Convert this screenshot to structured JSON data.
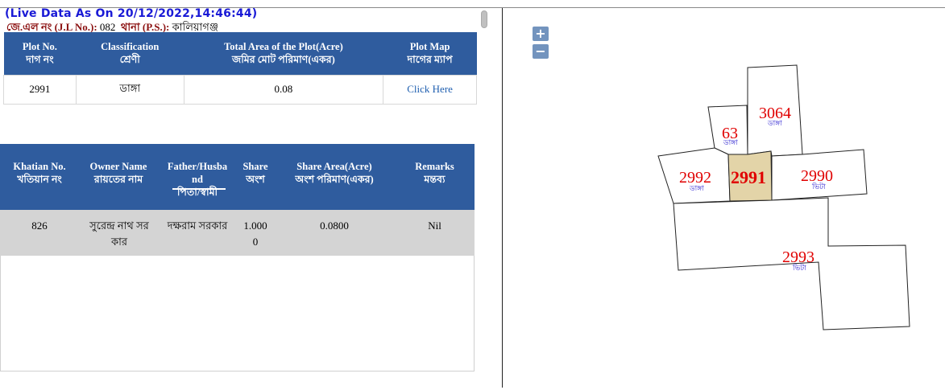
{
  "header": {
    "live_data": "(Live Data As On 20/12/2022,14:46:44)",
    "jl_label": "জে.এল নং (J.L No.):",
    "jl_value": "082",
    "ps_label": "থানা (P.S.):",
    "ps_value": "কালিয়াগঞ্জ"
  },
  "plot_table": {
    "headers": [
      {
        "en": "Plot No.",
        "bn": "দাগ নং"
      },
      {
        "en": "Classification",
        "bn": "শ্রেণী"
      },
      {
        "en": "Total Area of the Plot(Acre)",
        "bn": "জমির মোট পরিমাণ(একর)"
      },
      {
        "en": "Plot Map",
        "bn": "দাগের ম্যাপ"
      }
    ],
    "row": {
      "plot_no": "2991",
      "classification": "ডাঙ্গা",
      "total_area": "0.08",
      "plot_map_link": "Click Here"
    }
  },
  "owner_table": {
    "headers": [
      {
        "en": "Khatian No.",
        "bn": "খতিয়ান নং"
      },
      {
        "en": "Owner Name",
        "bn": "রায়তের নাম"
      },
      {
        "en": "Father/Husba nd",
        "bn": "পিতা/স্বামী"
      },
      {
        "en": "Share",
        "bn": "অংশ"
      },
      {
        "en": "Share Area(Acre)",
        "bn": "অংশ পরিমাণ(একর)"
      },
      {
        "en": "Remarks",
        "bn": "মন্তব্য"
      }
    ],
    "row": {
      "khatian_no": "826",
      "owner_name": "সুরেন্দ্র নাথ সর কার",
      "father_husband": "দক্ষরাম সরকার",
      "share": "1.000 0",
      "share_area": "0.0800",
      "remarks": "Nil"
    }
  },
  "map": {
    "zoom_in_label": "+",
    "zoom_out_label": "−",
    "plots": [
      {
        "number": "3064",
        "classification": "ডাঙ্গা"
      },
      {
        "number": "63",
        "classification": "ডাঙ্গা"
      },
      {
        "number": "2992",
        "classification": "ডাঙ্গা"
      },
      {
        "number": "2991",
        "classification": ""
      },
      {
        "number": "2990",
        "classification": "ভিটা"
      },
      {
        "number": "2993",
        "classification": "ভিটা"
      }
    ],
    "selected_fill": "#e3d4a8",
    "label_color": "#e00000",
    "class_color": "#2b20d0"
  }
}
